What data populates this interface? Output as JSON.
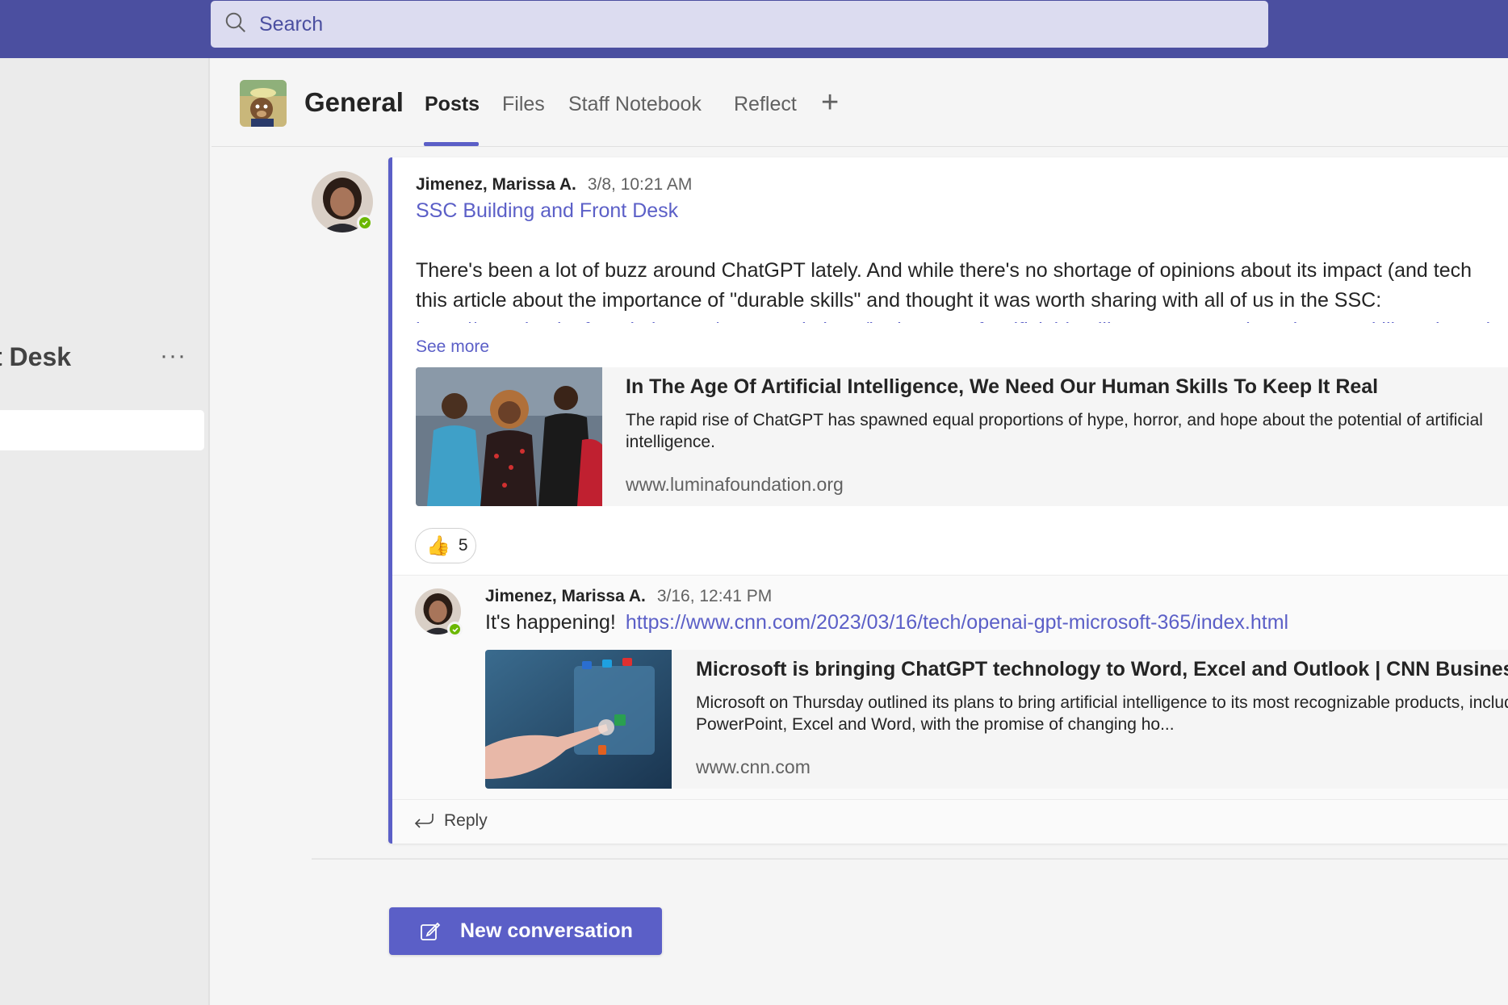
{
  "search": {
    "placeholder": "Search"
  },
  "sidebar": {
    "channel_name": "t Desk",
    "more_label": "···"
  },
  "header": {
    "title": "General",
    "tabs": [
      {
        "label": "Posts",
        "active": true
      },
      {
        "label": "Files"
      },
      {
        "label": "Staff Notebook"
      },
      {
        "label": "Reflect"
      }
    ],
    "add_tab_icon": "plus-icon"
  },
  "post": {
    "author": "Jimenez, Marissa A.",
    "time": "3/8, 10:21 AM",
    "subject": "SSC Building and Front Desk",
    "body_line1": "There's been a lot of buzz around ChatGPT lately.  And while there's no shortage of opinions about its impact (and tech",
    "body_line2": "this article about the importance of \"durable skills\" and thought it was worth sharing with all of us in the SSC:",
    "body_link": "https://www.luminafoundation.org/news-and-views/in-the-age-of-artificial-intelligence-we-need-our-human-skills-to-keep-it-real",
    "see_more": "See more",
    "card": {
      "title": "In The Age Of Artificial Intelligence, We Need Our Human Skills To Keep It Real",
      "description": "The rapid rise of ChatGPT has spawned equal proportions of hype, horror, and hope about the potential of artificial intelligence.",
      "domain": "www.luminafoundation.org"
    },
    "reaction": {
      "emoji": "👍",
      "count": "5"
    }
  },
  "reply": {
    "author": "Jimenez, Marissa A.",
    "time": "3/16, 12:41 PM",
    "text": "It's happening!",
    "link": "https://www.cnn.com/2023/03/16/tech/openai-gpt-microsoft-365/index.html",
    "card": {
      "title": "Microsoft is bringing ChatGPT technology to Word, Excel and Outlook | CNN Business",
      "description": "Microsoft on Thursday outlined its plans to bring artificial intelligence to its most recognizable products, including Outlook, PowerPoint, Excel and Word, with the promise of changing ho...",
      "domain": "www.cnn.com"
    }
  },
  "reply_button": "Reply",
  "new_conversation": "New conversation",
  "colors": {
    "brand": "#4b4fa0",
    "accent": "#5b5fc7",
    "presence": "#6bb700"
  }
}
